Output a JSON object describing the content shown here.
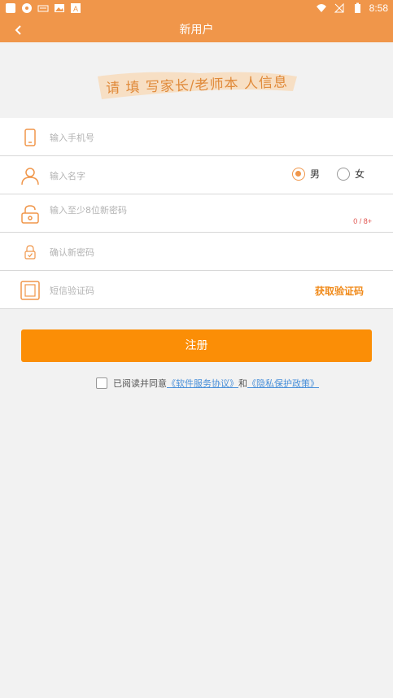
{
  "statusbar": {
    "time": "8:58",
    "left_icons": [
      "app-icon",
      "settings-icon",
      "keyboard-icon",
      "image-icon",
      "text-icon"
    ],
    "right_icons": [
      "wifi-icon",
      "no-signal-icon",
      "battery-icon"
    ]
  },
  "header": {
    "title": "新用户",
    "back_icon": "chevron-left-icon"
  },
  "banner": {
    "slogan": "请 填 写家长/老师本 人信息"
  },
  "form": {
    "phone_placeholder": "输入手机号",
    "name_placeholder": "输入名字",
    "gender_options": [
      "男",
      "女"
    ],
    "gender_selected": "男",
    "password_placeholder": "输入至少8位新密码",
    "password_counter": "0 / 8+",
    "confirm_placeholder": "确认新密码",
    "sms_placeholder": "短信验证码",
    "get_code_label": "获取验证码"
  },
  "submit_label": "注册",
  "agreement": {
    "prefix": "已阅读并同意",
    "link1": "《软件服务协议》",
    "middle": "和",
    "link2": "《隐私保护政策》",
    "checked": false
  },
  "colors": {
    "primary": "#f0964a",
    "button": "#fb8e06",
    "link": "#4a90d9",
    "counter": "#e0524c"
  }
}
